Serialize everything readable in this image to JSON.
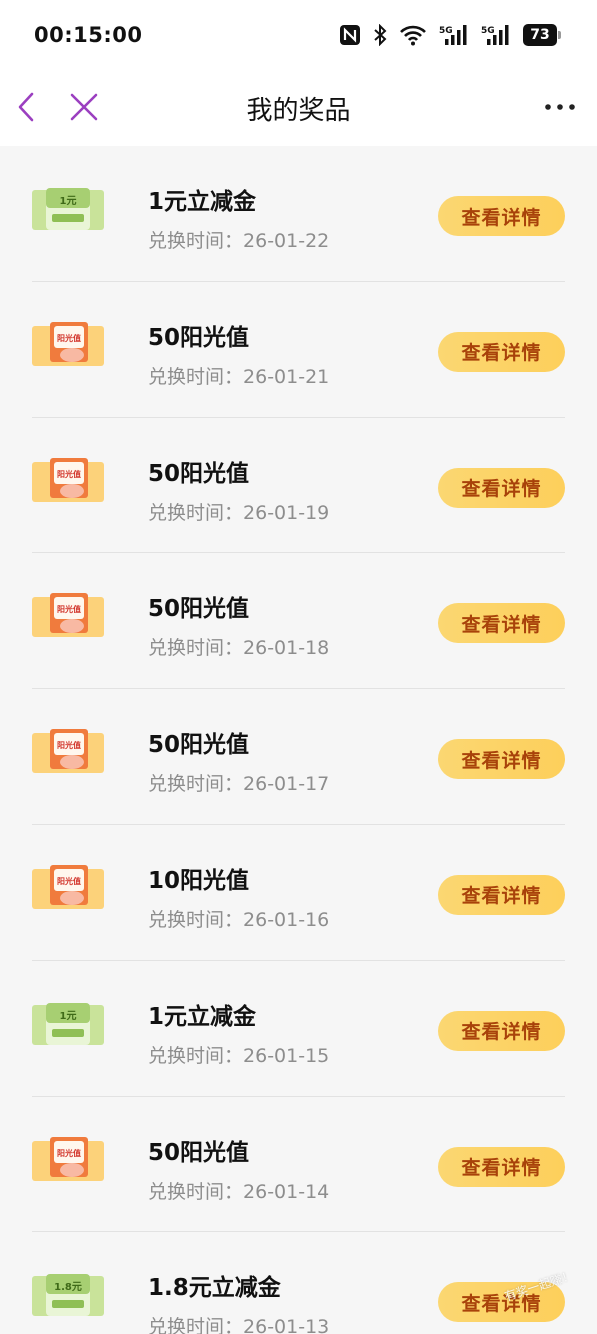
{
  "status_bar": {
    "time": "00:15:00",
    "battery": "73",
    "icons": [
      "nfc-icon",
      "bluetooth-icon",
      "wifi-icon",
      "signal-5g-icon",
      "signal-5g-icon"
    ]
  },
  "nav": {
    "title": "我的奖品",
    "back_icon": "chevron-left-icon",
    "close_icon": "close-icon",
    "more_icon": "more-dots-icon"
  },
  "colors": {
    "button_bg": "#fcd468",
    "button_text": "#a8420a",
    "nav_icon": "#9b3fc0",
    "date_text": "#8d8d8d"
  },
  "prizes": [
    {
      "title": "1元立减金",
      "date_label": "兑换时间：",
      "date": "26-01-22",
      "button": "查看详情",
      "thumb": "green",
      "thumb_text": "1元"
    },
    {
      "title": "50阳光值",
      "date_label": "兑换时间：",
      "date": "26-01-21",
      "button": "查看详情",
      "thumb": "orange",
      "thumb_text": "阳光值"
    },
    {
      "title": "50阳光值",
      "date_label": "兑换时间：",
      "date": "26-01-19",
      "button": "查看详情",
      "thumb": "orange",
      "thumb_text": "阳光值"
    },
    {
      "title": "50阳光值",
      "date_label": "兑换时间：",
      "date": "26-01-18",
      "button": "查看详情",
      "thumb": "orange",
      "thumb_text": "阳光值"
    },
    {
      "title": "50阳光值",
      "date_label": "兑换时间：",
      "date": "26-01-17",
      "button": "查看详情",
      "thumb": "orange",
      "thumb_text": "阳光值"
    },
    {
      "title": "10阳光值",
      "date_label": "兑换时间：",
      "date": "26-01-16",
      "button": "查看详情",
      "thumb": "orange",
      "thumb_text": "阳光值"
    },
    {
      "title": "1元立减金",
      "date_label": "兑换时间：",
      "date": "26-01-15",
      "button": "查看详情",
      "thumb": "green",
      "thumb_text": "1元"
    },
    {
      "title": "50阳光值",
      "date_label": "兑换时间：",
      "date": "26-01-14",
      "button": "查看详情",
      "thumb": "orange",
      "thumb_text": "阳光值"
    },
    {
      "title": "1.8元立减金",
      "date_label": "兑换时间：",
      "date": "26-01-13",
      "button": "查看详情",
      "thumb": "green",
      "thumb_text": "1.8元"
    }
  ],
  "watermark": "有奖一起赚！"
}
